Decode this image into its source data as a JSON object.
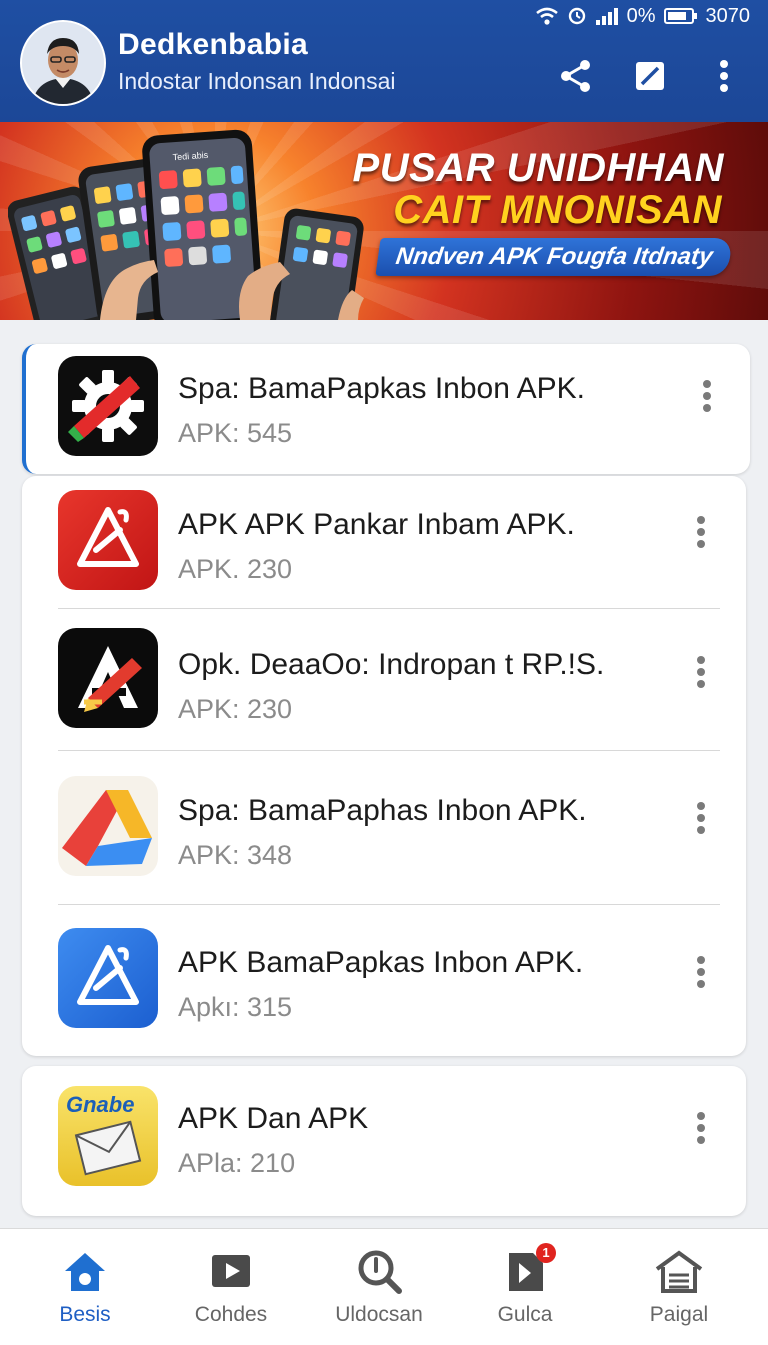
{
  "status_bar": {
    "battery_text": "0%",
    "time": "3070"
  },
  "header": {
    "title": "Dedkenbabia",
    "subtitle": "Indostar Indonsan Indonsai"
  },
  "banner": {
    "line1": "PUSAR UNIDHHAN",
    "line2": "CAIT MNONISAN",
    "pill": "Nndven APK Fougfa Itdnaty",
    "phone_label": "Tedi abis"
  },
  "apps": [
    {
      "title": "Spa: BamaPapkas Inbon APK.",
      "subtitle": "APK: 545",
      "icon": "gear-slash-icon"
    },
    {
      "title": "APK APK Pankar Inbam APK.",
      "subtitle": "APK. 230",
      "icon": "triangle-logo-red-icon"
    },
    {
      "title": "Opk. DeaaOo: Indropan t RP.!S.",
      "subtitle": "APK: 230",
      "icon": "a-pencil-icon"
    },
    {
      "title": "Spa: BamaPaphas Inbon APK.",
      "subtitle": "APK: 348",
      "icon": "colorful-triangle-icon"
    },
    {
      "title": "APK BamaPapkas Inbon APK.",
      "subtitle": "Apkı: 315",
      "icon": "triangle-logo-blue-icon"
    },
    {
      "title": "APK Dan APK",
      "subtitle": "APla: 210",
      "icon": "envelope-gnabe-icon",
      "icon_text": "Gnabe"
    }
  ],
  "nav": [
    {
      "label": "Besis",
      "icon": "home-icon",
      "active": true
    },
    {
      "label": "Cohdes",
      "icon": "play-icon"
    },
    {
      "label": "Uldocsan",
      "icon": "search-icon"
    },
    {
      "label": "Gulca",
      "icon": "document-icon",
      "badge": "1"
    },
    {
      "label": "Paigal",
      "icon": "warehouse-icon"
    }
  ],
  "colors": {
    "header_bg": "#1f4fa3",
    "accent": "#1f6fd0",
    "badge": "#e0241f"
  }
}
